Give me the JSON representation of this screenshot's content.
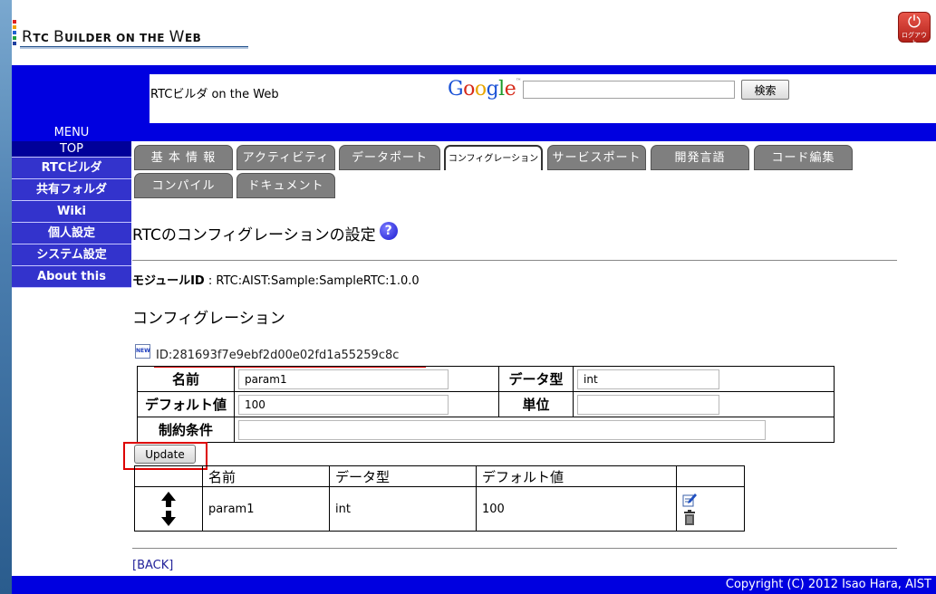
{
  "header": {
    "logo_text_big_r": "R",
    "logo_text_small_1": "TC ",
    "logo_text_big_b": "B",
    "logo_text_small_2": "UILDER ON THE ",
    "logo_text_big_w": "W",
    "logo_text_small_3": "EB",
    "logout_label": "ログアウト",
    "site_title": "RTCビルダ on the Web",
    "google_logo": "Google",
    "search_value": "",
    "search_button": "検索",
    "menu_label": "MENU"
  },
  "sidebar": {
    "items": [
      {
        "label": "TOP"
      },
      {
        "label": "RTCビルダ"
      },
      {
        "label": "共有フォルダ"
      },
      {
        "label": "Wiki"
      },
      {
        "label": "個人設定"
      },
      {
        "label": "システム設定"
      },
      {
        "label": "About this"
      }
    ]
  },
  "tabs": [
    {
      "label": "基 本 情 報"
    },
    {
      "label": "アクティビティ"
    },
    {
      "label": "データポート"
    },
    {
      "label": "コンフィグレーション"
    },
    {
      "label": "サービスポート"
    },
    {
      "label": "開発言語"
    },
    {
      "label": "コード編集"
    },
    {
      "label": "コンパイル"
    },
    {
      "label": "ドキュメント"
    }
  ],
  "page": {
    "heading": "RTCのコンフィグレーションの設定",
    "module_label": "モジュールID",
    "module_value": ": RTC:AIST:Sample:SampleRTC:1.0.0",
    "section_title": "コンフィグレーション",
    "new_icon_text": "NEW",
    "config_id": "ID:281693f7e9ebf2d00e02fd1a55259c8c"
  },
  "form": {
    "name_label": "名前",
    "name_value": "param1",
    "type_label": "データ型",
    "type_value": "int",
    "default_label": "デフォルト値",
    "default_value": "100",
    "unit_label": "単位",
    "unit_value": "",
    "constraint_label": "制約条件",
    "constraint_value": "",
    "update_button": "Update"
  },
  "list": {
    "headers": [
      "",
      "名前",
      "データ型",
      "デフォルト値",
      ""
    ],
    "rows": [
      {
        "name": "param1",
        "type": "int",
        "default": "100"
      }
    ]
  },
  "footer": {
    "back_link": "[BACK]",
    "copyright": "Copyright (C) 2012 Isao Hara, AIST"
  }
}
